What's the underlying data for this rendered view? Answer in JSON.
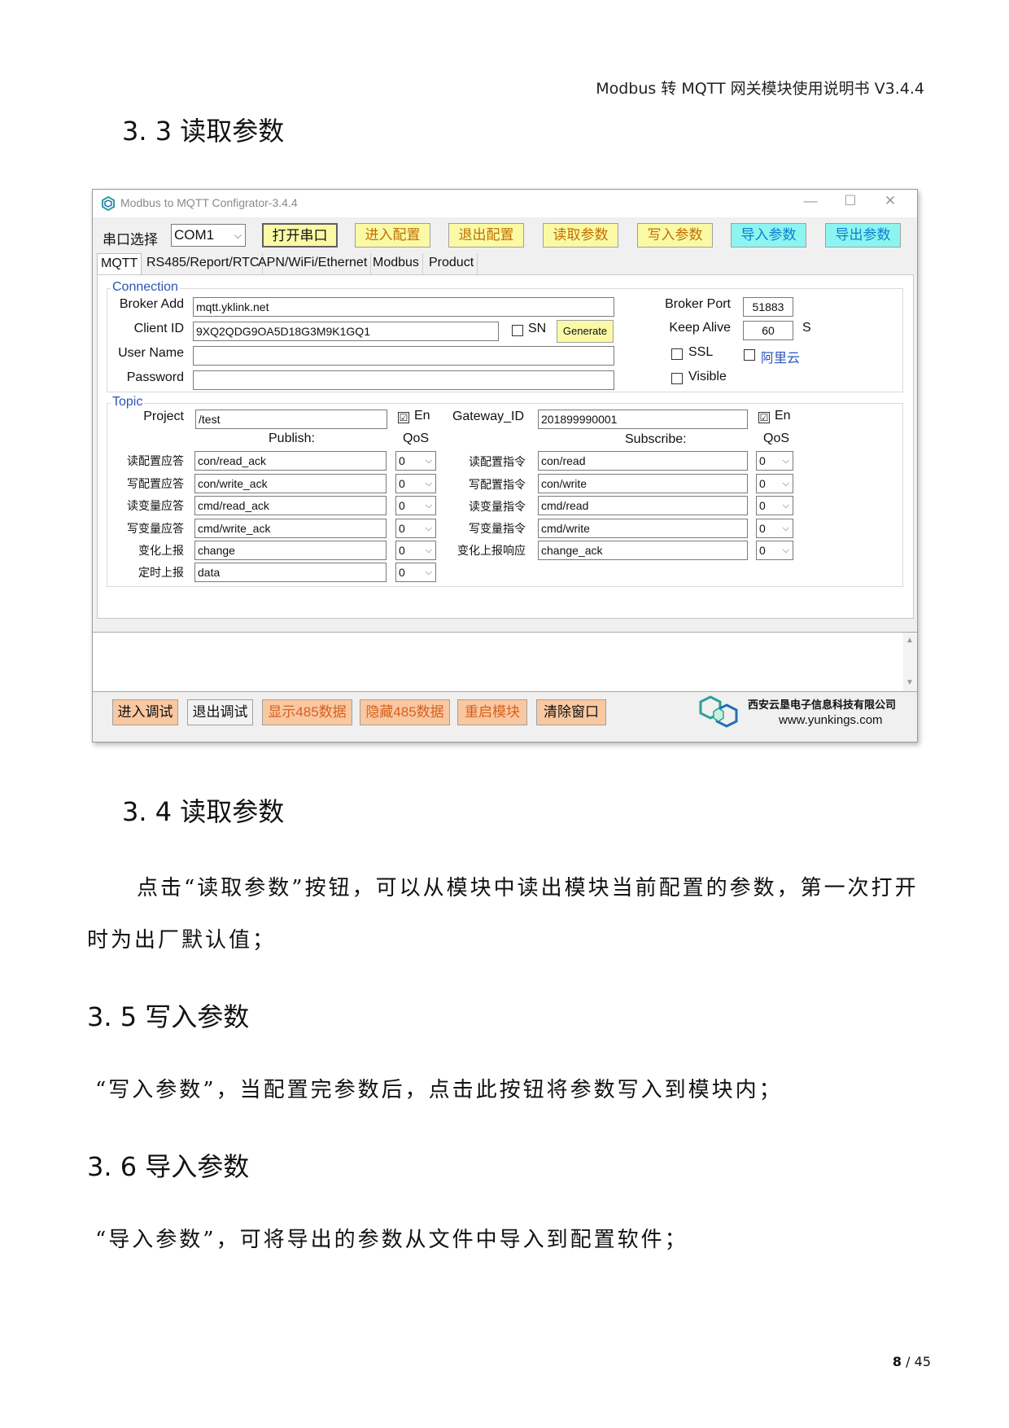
{
  "doc": {
    "running_header": "Modbus 转 MQTT 网关模块使用说明书 V3.4.4",
    "sections": [
      {
        "heading": "3. 3 读取参数"
      },
      {
        "heading": "3. 4 读取参数",
        "paragraph_line1": "点击“读取参数”按钮，可以从模块中读出模块当前配置的参数，第一次打开",
        "paragraph_line2": "时为出厂默认值；"
      },
      {
        "heading": "3. 5 写入参数",
        "paragraph": "“写入参数”，当配置完参数后，点击此按钮将参数写入到模块内；"
      },
      {
        "heading": "3. 6 导入参数",
        "paragraph": "“导入参数”，可将导出的参数从文件中导入到配置软件；"
      }
    ],
    "page_current": "8",
    "page_total": "/ 45"
  },
  "app": {
    "title": "Modbus to MQTT Configrator-3.4.4",
    "window_controls": {
      "minimize": "—",
      "maximize": "☐",
      "close": "✕"
    },
    "serial_label": "串口选择",
    "serial_port": "COM1",
    "toolbar": {
      "open_port": "打开串口",
      "enter_config": "进入配置",
      "exit_config": "退出配置",
      "read_params": "读取参数",
      "write_params": "写入参数",
      "import_params": "导入参数",
      "export_params": "导出参数"
    },
    "tabs": [
      "MQTT",
      "RS485/Report/RTC",
      "APN/WiFi/Ethernet",
      "Modbus",
      "Product"
    ],
    "connection": {
      "group_label": "Connection",
      "broker_add_label": "Broker Add",
      "broker_add": "mqtt.yklink.net",
      "client_id_label": "Client ID",
      "client_id": "9XQ2QDG9OA5D18G3M9K1GQ1",
      "sn_label": "SN",
      "generate": "Generate",
      "user_name_label": "User Name",
      "user_name": "",
      "password_label": "Password",
      "password": "",
      "broker_port_label": "Broker Port",
      "broker_port": "51883",
      "keep_alive_label": "Keep Alive",
      "keep_alive": "60",
      "keep_alive_unit": "S",
      "ssl_label": "SSL",
      "aliyun_label": "阿里云",
      "visible_label": "Visible"
    },
    "topic": {
      "group_label": "Topic",
      "project_label": "Project",
      "project": "/test",
      "en_label": "En",
      "en_check": "☑",
      "gateway_id_label": "Gateway_ID",
      "gateway_id": "201899990001",
      "publish_header": "Publish:",
      "subscribe_header": "Subscribe:",
      "qos_header": "QoS",
      "publish_rows": [
        {
          "label": "读配置应答",
          "topic": "con/read_ack",
          "qos": "0"
        },
        {
          "label": "写配置应答",
          "topic": "con/write_ack",
          "qos": "0"
        },
        {
          "label": "读变量应答",
          "topic": "cmd/read_ack",
          "qos": "0"
        },
        {
          "label": "写变量应答",
          "topic": "cmd/write_ack",
          "qos": "0"
        },
        {
          "label": "变化上报",
          "topic": "change",
          "qos": "0"
        },
        {
          "label": "定时上报",
          "topic": "data",
          "qos": "0"
        }
      ],
      "subscribe_rows": [
        {
          "label": "读配置指令",
          "topic": "con/read",
          "qos": "0"
        },
        {
          "label": "写配置指令",
          "topic": "con/write",
          "qos": "0"
        },
        {
          "label": "读变量指令",
          "topic": "cmd/read",
          "qos": "0"
        },
        {
          "label": "写变量指令",
          "topic": "cmd/write",
          "qos": "0"
        },
        {
          "label": "变化上报响应",
          "topic": "change_ack",
          "qos": "0"
        }
      ]
    },
    "bottom_buttons": {
      "enter_debug": "进入调试",
      "exit_debug": "退出调试",
      "show_485": "显示485数据",
      "hide_485": "隐藏485数据",
      "restart": "重启模块",
      "clear_window": "清除窗口"
    },
    "company_name": "西安云垦电子信息科技有限公司",
    "company_url": "www.yunkings.com",
    "colors": {
      "blue_label": "#2a55b5",
      "yellow_btn": "#fafaa6",
      "cyan_btn": "#8ef4f0",
      "orange_btn": "#f9c8a0",
      "logo_green": "#2aa198",
      "logo_blue": "#1f6fb5"
    }
  }
}
